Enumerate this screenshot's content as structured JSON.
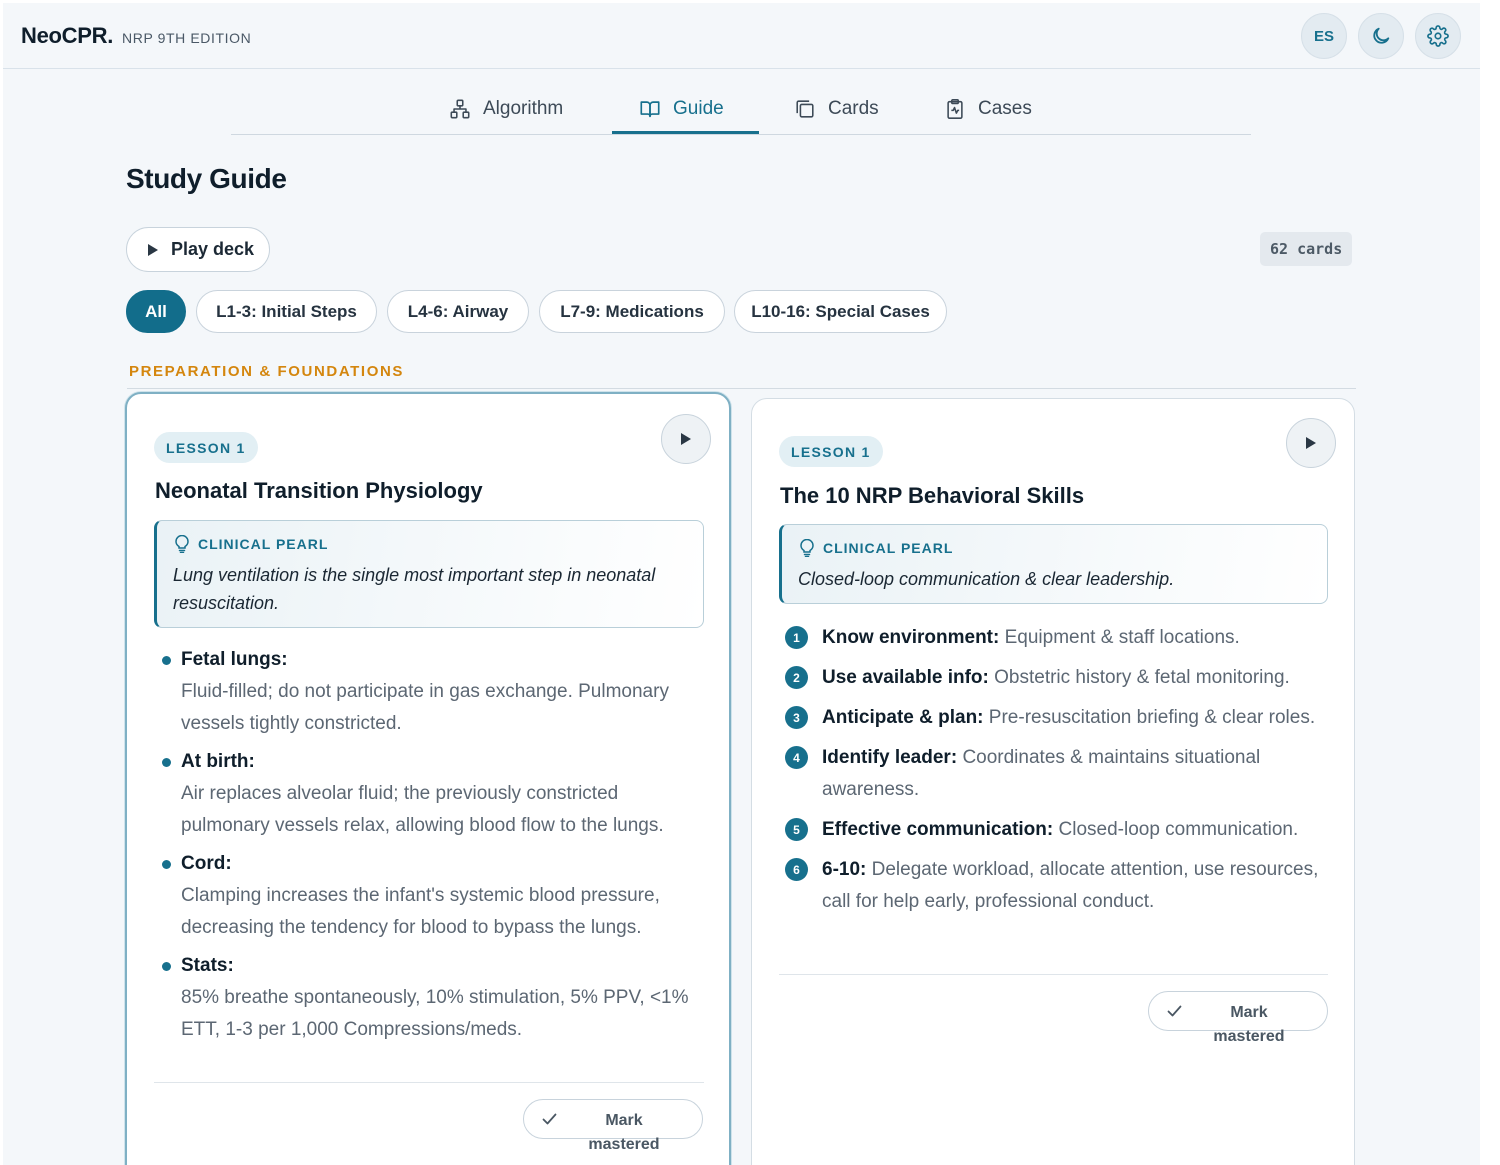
{
  "header": {
    "brand": "NeoCPR.",
    "edition": "NRP 9TH EDITION",
    "lang_button": "ES",
    "theme_icon": "moon-icon",
    "settings_icon": "gear-icon"
  },
  "tabs": [
    {
      "label": "Algorithm",
      "icon": "flowchart-icon",
      "active": false
    },
    {
      "label": "Guide",
      "icon": "book-icon",
      "active": true
    },
    {
      "label": "Cards",
      "icon": "cards-icon",
      "active": false
    },
    {
      "label": "Cases",
      "icon": "clipboard-icon",
      "active": false
    }
  ],
  "page": {
    "title": "Study Guide",
    "play_deck_label": "Play deck",
    "card_count": "62 cards"
  },
  "filters": [
    {
      "label": "All",
      "active": true
    },
    {
      "label": "L1-3: Initial Steps",
      "active": false
    },
    {
      "label": "L4-6: Airway",
      "active": false
    },
    {
      "label": "L7-9: Medications",
      "active": false
    },
    {
      "label": "L10-16: Special Cases",
      "active": false
    }
  ],
  "section": {
    "heading": "PREPARATION & FOUNDATIONS"
  },
  "cards": [
    {
      "lesson": "LESSON 1",
      "title": "Neonatal Transition Physiology",
      "pearl_label": "CLINICAL PEARL",
      "pearl_text": "Lung ventilation is the single most important step in neonatal resuscitation.",
      "points": [
        {
          "term": "Fetal lungs:",
          "desc": "Fluid-filled; do not participate in gas exchange. Pulmonary vessels tightly constricted."
        },
        {
          "term": "At birth:",
          "desc": "Air replaces alveolar fluid; the previously constricted pulmonary vessels relax, allowing blood flow to the lungs."
        },
        {
          "term": "Cord:",
          "desc": "Clamping increases the infant's systemic blood pressure, decreasing the tendency for blood to bypass the lungs."
        },
        {
          "term": "Stats:",
          "desc": "85% breathe spontaneously, 10% stimulation, 5% PPV, <1% ETT, 1-3 per 1,000 Compressions/meds."
        }
      ],
      "mark_label": "Mark mastered"
    },
    {
      "lesson": "LESSON 1",
      "title": "The 10 NRP Behavioral Skills",
      "pearl_label": "CLINICAL PEARL",
      "pearl_text": "Closed-loop communication & clear leadership.",
      "steps": [
        {
          "num": "1",
          "term": "Know environment:",
          "desc": "Equipment & staff locations."
        },
        {
          "num": "2",
          "term": "Use available info:",
          "desc": "Obstetric history & fetal monitoring."
        },
        {
          "num": "3",
          "term": "Anticipate & plan:",
          "desc": "Pre-resuscitation briefing & clear roles."
        },
        {
          "num": "4",
          "term": "Identify leader:",
          "desc": "Coordinates & maintains situational awareness."
        },
        {
          "num": "5",
          "term": "Effective communication:",
          "desc": "Closed-loop communication."
        },
        {
          "num": "6",
          "term": "6-10:",
          "desc": "Delegate workload, allocate attention, use resources, call for help early, professional conduct."
        }
      ],
      "mark_label": "Mark mastered"
    }
  ],
  "colors": {
    "accent": "#17708d",
    "section": "#d4860e",
    "background": "#f4f7fa"
  }
}
